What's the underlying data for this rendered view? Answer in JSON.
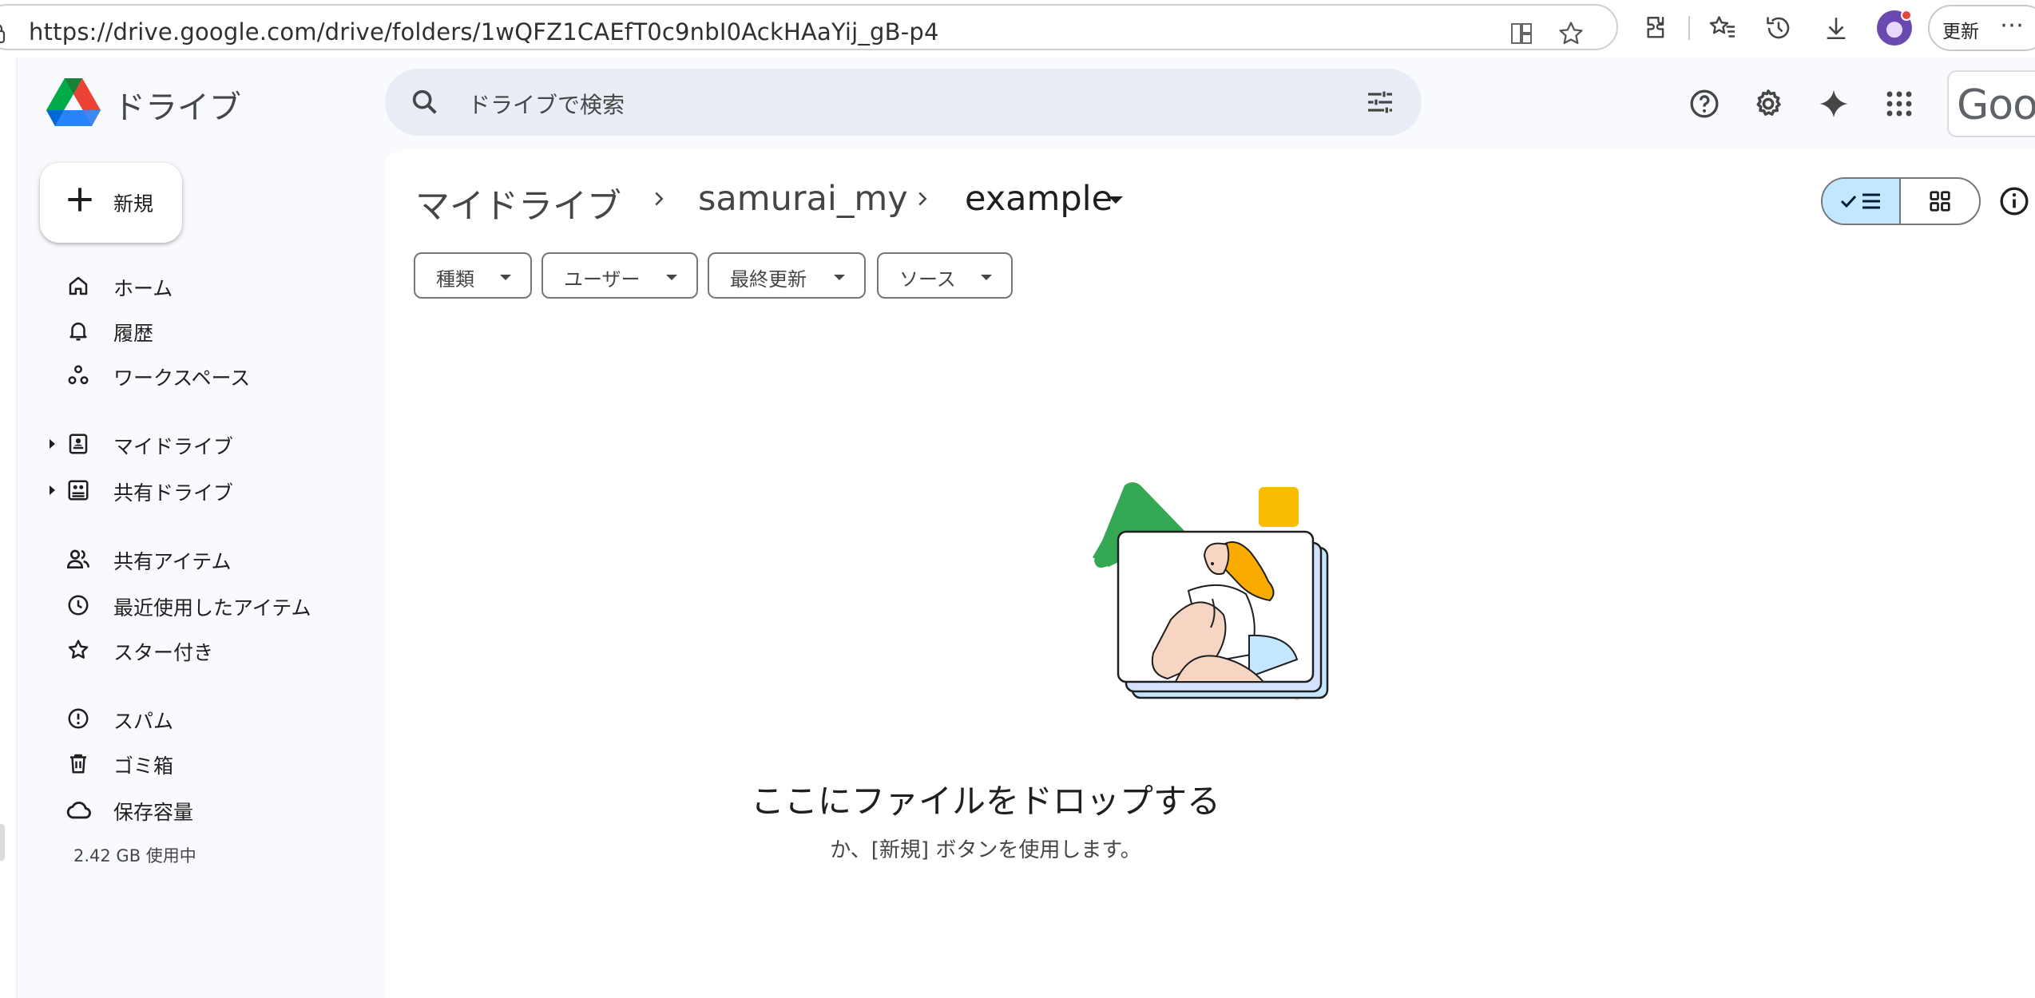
{
  "browser": {
    "url": "https://drive.google.com/drive/folders/1wQFZ1CAEfT0c9nbI0AckHAaYij_gB-p4",
    "update_label": "更新",
    "more_label": "⋯"
  },
  "app": {
    "logo_text": "ドライブ",
    "search_placeholder": "ドライブで検索",
    "account_text": "Goog"
  },
  "sidebar": {
    "new_label": "新規",
    "items": [
      {
        "label": "ホーム",
        "icon": "home-icon"
      },
      {
        "label": "履歴",
        "icon": "bell-icon"
      },
      {
        "label": "ワークスペース",
        "icon": "workspaces-icon"
      },
      {
        "label": "マイドライブ",
        "icon": "my-drive-icon"
      },
      {
        "label": "共有ドライブ",
        "icon": "shared-drives-icon"
      },
      {
        "label": "共有アイテム",
        "icon": "shared-people-icon"
      },
      {
        "label": "最近使用したアイテム",
        "icon": "clock-icon"
      },
      {
        "label": "スター付き",
        "icon": "star-icon"
      },
      {
        "label": "スパム",
        "icon": "spam-icon"
      },
      {
        "label": "ゴミ箱",
        "icon": "trash-icon"
      },
      {
        "label": "保存容量",
        "icon": "cloud-icon"
      }
    ],
    "storage_text": "2.42 GB 使用中"
  },
  "main": {
    "breadcrumb": [
      "マイドライブ",
      "samurai_my",
      "example"
    ],
    "filters": [
      "種類",
      "ユーザー",
      "最終更新",
      "ソース"
    ],
    "empty_title": "ここにファイルをドロップする",
    "empty_subtitle": "か、[新規] ボタンを使用します。"
  },
  "colors": {
    "accent_selected": "#c2e7ff",
    "search_bg": "#e9eef6",
    "app_bg": "#f8fafd"
  }
}
